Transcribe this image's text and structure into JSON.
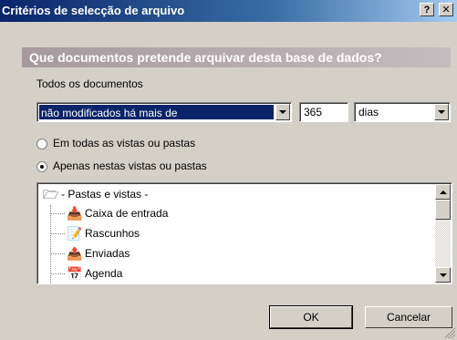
{
  "window": {
    "title": "Critérios de selecção de arquivo",
    "help_glyph": "?",
    "close_glyph": "✕"
  },
  "banner": {
    "text": "Que documentos pretende arquivar desta base de dados?"
  },
  "filter": {
    "label": "Todos os documentos",
    "condition_value": "não modificados há mais de",
    "days_value": "365",
    "unit_value": "dias"
  },
  "scope": {
    "option_all": "Em todas as vistas ou pastas",
    "option_selected": "Apenas nestas vistas ou pastas",
    "selected": "option_selected"
  },
  "tree": {
    "root": {
      "label": "- Pastas e vistas -",
      "icon": "folder-open-icon"
    },
    "items": [
      {
        "label": "Caixa de entrada",
        "icon": "inbox-icon"
      },
      {
        "label": "Rascunhos",
        "icon": "drafts-icon"
      },
      {
        "label": "Enviadas",
        "icon": "sent-icon"
      },
      {
        "label": "Agenda",
        "icon": "calendar-icon"
      }
    ]
  },
  "buttons": {
    "ok": "OK",
    "cancel": "Cancelar"
  }
}
